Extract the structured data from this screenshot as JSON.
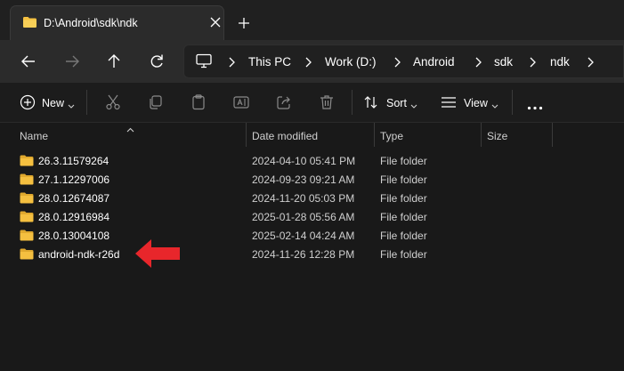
{
  "window": {
    "tab_title": "D:\\Android\\sdk\\ndk"
  },
  "address_bar": {
    "crumbs": [
      "This PC",
      "Work (D:)",
      "Android",
      "sdk",
      "ndk"
    ]
  },
  "toolbar": {
    "new_label": "New",
    "sort_label": "Sort",
    "view_label": "View"
  },
  "columns": {
    "name": "Name",
    "date_modified": "Date modified",
    "type": "Type",
    "size": "Size"
  },
  "files": [
    {
      "name": "26.3.11579264",
      "date": "2024-04-10 05:41 PM",
      "type": "File folder",
      "size": ""
    },
    {
      "name": "27.1.12297006",
      "date": "2024-09-23 09:21 AM",
      "type": "File folder",
      "size": ""
    },
    {
      "name": "28.0.12674087",
      "date": "2024-11-20 05:03 PM",
      "type": "File folder",
      "size": ""
    },
    {
      "name": "28.0.12916984",
      "date": "2025-01-28 05:56 AM",
      "type": "File folder",
      "size": ""
    },
    {
      "name": "28.0.13004108",
      "date": "2025-02-14 04:24 AM",
      "type": "File folder",
      "size": ""
    },
    {
      "name": "android-ndk-r26d",
      "date": "2024-11-26 12:28 PM",
      "type": "File folder",
      "size": ""
    }
  ],
  "colors": {
    "background": "#191919",
    "folder": "#f5c040",
    "annotation_arrow": "#e8262b"
  }
}
